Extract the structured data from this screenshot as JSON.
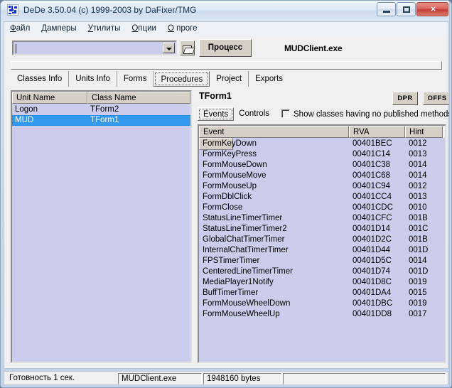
{
  "window": {
    "title": "DeDe 3.50.04 (c) 1999-2003 by DaFixer/TMG",
    "icon": "app-icon",
    "buttons": {
      "minimize": "minimize-icon",
      "maximize": "maximize-icon",
      "close": "×"
    }
  },
  "menu": {
    "items": [
      {
        "accel": "Ф",
        "rest": "айл"
      },
      {
        "accel": "Д",
        "rest": "амперы"
      },
      {
        "accel": "У",
        "rest": "тилиты"
      },
      {
        "accel": "О",
        "rest": "пции"
      },
      {
        "accel": "О",
        "rest": " проге"
      }
    ]
  },
  "toolbar": {
    "combo_value": "",
    "combo_placeholder": "",
    "open_button_icon": "open-folder-icon",
    "process_button": "Процесс",
    "exe_name": "MUDClient.exe"
  },
  "tabs": {
    "items": [
      "Classes Info",
      "Units Info",
      "Forms",
      "Procedures",
      "Project",
      "Exports"
    ],
    "active": "Procedures"
  },
  "left_list": {
    "columns": [
      "Unit Name",
      "Class Name"
    ],
    "rows": [
      {
        "unit": "Logon",
        "cls": "TForm2",
        "selected": false
      },
      {
        "unit": "MUD",
        "cls": "TForm1",
        "selected": true
      }
    ]
  },
  "right_pane": {
    "form_title": "TForm1",
    "dpr_button": "DPR",
    "offs_button": "OFFS",
    "subtabs": {
      "items": [
        "Events",
        "Controls"
      ],
      "active": "Events"
    },
    "checkbox": {
      "label": "Show classes having no published methods",
      "checked": false
    },
    "columns": [
      "Event",
      "RVA",
      "Hint",
      ""
    ],
    "rows": [
      {
        "event": "FormKeyDown",
        "rva": "00401BEC",
        "hint": "0012"
      },
      {
        "event": "FormKeyPress",
        "rva": "00401C14",
        "hint": "0013"
      },
      {
        "event": "FormMouseDown",
        "rva": "00401C38",
        "hint": "0014"
      },
      {
        "event": "FormMouseMove",
        "rva": "00401C68",
        "hint": "0014"
      },
      {
        "event": "FormMouseUp",
        "rva": "00401C94",
        "hint": "0012"
      },
      {
        "event": "FormDblClick",
        "rva": "00401CC4",
        "hint": "0013"
      },
      {
        "event": "FormClose",
        "rva": "00401CDC",
        "hint": "0010"
      },
      {
        "event": "StatusLineTimerTimer",
        "rva": "00401CFC",
        "hint": "001B"
      },
      {
        "event": "StatusLineTimerTimer2",
        "rva": "00401D14",
        "hint": "001C"
      },
      {
        "event": "GlobalChatTimerTimer",
        "rva": "00401D2C",
        "hint": "001B"
      },
      {
        "event": "InternalChatTimerTimer",
        "rva": "00401D44",
        "hint": "001D"
      },
      {
        "event": "FPSTimerTimer",
        "rva": "00401D5C",
        "hint": "0014"
      },
      {
        "event": "CenteredLineTimerTimer",
        "rva": "00401D74",
        "hint": "001D"
      },
      {
        "event": "MediaPlayer1Notify",
        "rva": "00401D8C",
        "hint": "0019"
      },
      {
        "event": "BuffTimerTimer",
        "rva": "00401DA4",
        "hint": "0015"
      },
      {
        "event": "FormMouseWheelDown",
        "rva": "00401DBC",
        "hint": "0019"
      },
      {
        "event": "FormMouseWheelUp",
        "rva": "00401DD8",
        "hint": "0017"
      }
    ]
  },
  "statusbar": {
    "ready": "Готовность 1 сек.",
    "file": "MUDClient.exe",
    "size": "1948160 bytes",
    "extra": ""
  },
  "colors": {
    "selection": "#3399ee",
    "list_background": "#ccccec",
    "face": "#d4d0c8",
    "close_button": "#c23c33"
  }
}
